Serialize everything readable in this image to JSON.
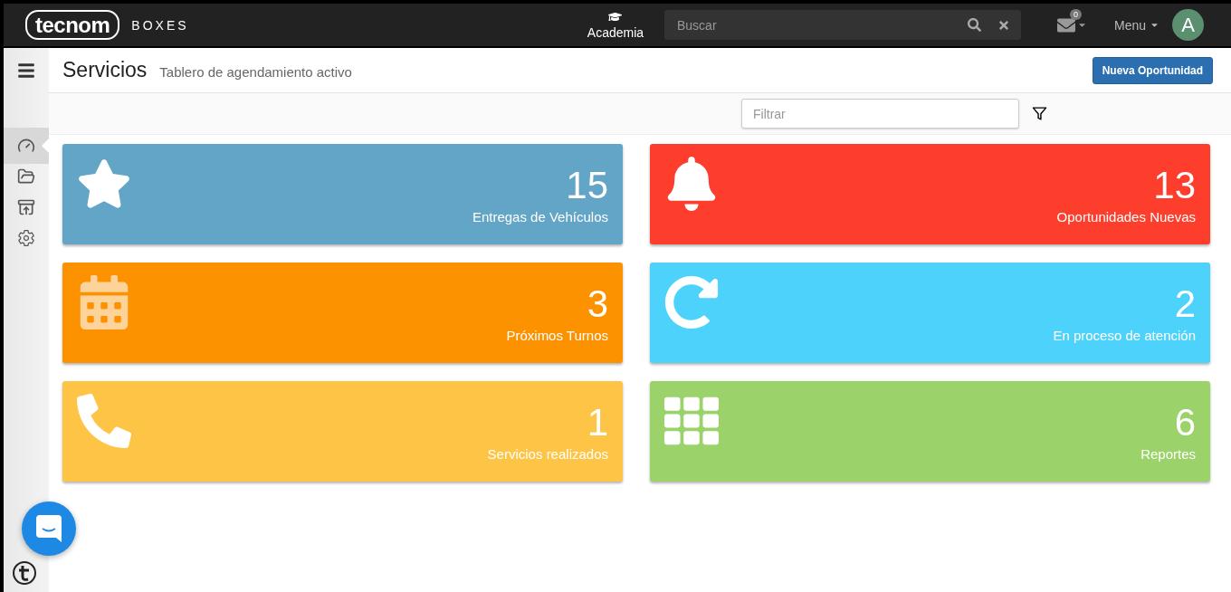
{
  "topbar": {
    "logo": "tecnom",
    "product": "BOXES",
    "academia": "Academia",
    "search": {
      "placeholder": "Buscar"
    },
    "mail_count": "0",
    "menu": "Menu",
    "avatar": "A"
  },
  "sidebar": {
    "items": [
      {
        "kind": "gauge",
        "selected": true
      },
      {
        "kind": "folder",
        "selected": false
      },
      {
        "kind": "inbox",
        "selected": false
      },
      {
        "kind": "gears",
        "selected": false
      }
    ]
  },
  "header": {
    "title": "Servicios",
    "subtitle": "Tablero de agendamiento activo",
    "button": "Nueva Oportunidad"
  },
  "filter": {
    "placeholder": "Filtrar"
  },
  "cards": [
    {
      "kind": "star",
      "color": "#63a5c6",
      "count": "15",
      "label": "Entregas de Vehículos"
    },
    {
      "kind": "bell",
      "color": "#fd3e2c",
      "count": "13",
      "label": "Oportunidades Nuevas"
    },
    {
      "kind": "calendar",
      "color": "#fd9200",
      "count": "3",
      "label": "Próximos Turnos"
    },
    {
      "kind": "refresh",
      "color": "#4dd3fb",
      "count": "2",
      "label": "En proceso de atención"
    },
    {
      "kind": "phone",
      "color": "#fec445",
      "count": "1",
      "label": "Servicios realizados"
    },
    {
      "kind": "grid",
      "color": "#9bd36a",
      "count": "6",
      "label": "Reportes"
    }
  ]
}
